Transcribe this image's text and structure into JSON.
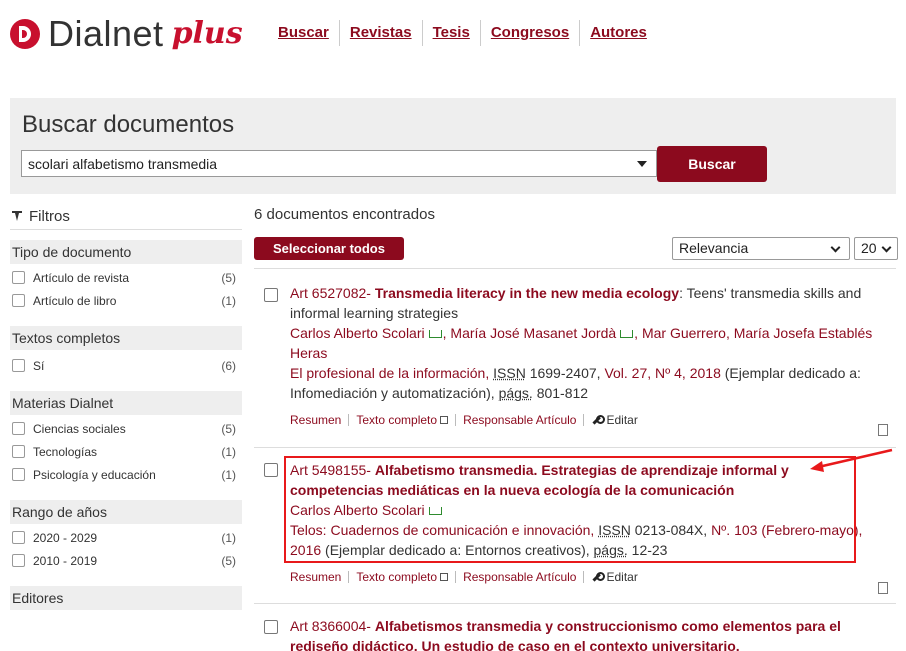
{
  "brand": {
    "name": "Dialnet",
    "suffix": "plus"
  },
  "nav": [
    "Buscar",
    "Revistas",
    "Tesis",
    "Congresos",
    "Autores"
  ],
  "search": {
    "title": "Buscar documentos",
    "query": "scolari alfabetismo transmedia",
    "button": "Buscar"
  },
  "sidebar": {
    "filters_label": "Filtros",
    "groups": [
      {
        "title": "Tipo de documento",
        "facets": [
          {
            "label": "Artículo de revista",
            "count": "(5)"
          },
          {
            "label": "Artículo de libro",
            "count": "(1)"
          }
        ]
      },
      {
        "title": "Textos completos",
        "facets": [
          {
            "label": "Sí",
            "count": "(6)"
          }
        ]
      },
      {
        "title": "Materias Dialnet",
        "facets": [
          {
            "label": "Ciencias sociales",
            "count": "(5)"
          },
          {
            "label": "Tecnologías",
            "count": "(1)"
          },
          {
            "label": "Psicología y educación",
            "count": "(1)"
          }
        ]
      },
      {
        "title": "Rango de años",
        "facets": [
          {
            "label": "2020 - 2029",
            "count": "(1)"
          },
          {
            "label": "2010 - 2019",
            "count": "(5)"
          }
        ]
      },
      {
        "title": "Editores",
        "facets": []
      }
    ]
  },
  "results": {
    "count_text": "6 documentos encontrados",
    "select_all": "Seleccionar todos",
    "sort": "Relevancia",
    "per_page": "20",
    "actions": {
      "summary": "Resumen",
      "fulltext": "Texto completo",
      "responsible": "Responsable Artículo",
      "edit": "Editar"
    },
    "items": [
      {
        "code": "Art 6527082-",
        "title": "Transmedia literacy in the new media ecology",
        "subtitle": ": Teens' transmedia skills and informal learning strategies",
        "authors": [
          "Carlos Alberto Scolari",
          "María José Masanet Jordà",
          "Mar Guerrero, María Josefa Establés Heras"
        ],
        "journal": "El profesional de la información,",
        "issn_label": "ISSN",
        "issn": "1699-2407,",
        "volume": "Vol. 27, Nº 4, 2018",
        "note": "(Ejemplar dedicado a: Infomediación y automatización),",
        "pages_label": "págs.",
        "pages": "801-812"
      },
      {
        "code": "Art 5498155-",
        "title": "Alfabetismo transmedia. Estrategias de aprendizaje informal y competencias mediáticas en la nueva ecología de la comunicación",
        "authors": [
          "Carlos Alberto Scolari"
        ],
        "journal": "Telos: Cuadernos de comunicación e innovación,",
        "issn_label": "ISSN",
        "issn": "0213-084X,",
        "volume": "Nº. 103 (Febrero-mayo), 2016",
        "note": "(Ejemplar dedicado a: Entornos creativos),",
        "pages_label": "págs.",
        "pages": "12-23"
      },
      {
        "code": "Art 8366004-",
        "title": "Alfabetismos transmedia y construccionismo como elementos para el rediseño didáctico. Un estudio de caso en el contexto universitario."
      }
    ]
  },
  "colors": {
    "brand_red": "#c8102e",
    "dark_red": "#8c0a1e",
    "highlight": "#e8191b",
    "band": "#eeeeee"
  }
}
